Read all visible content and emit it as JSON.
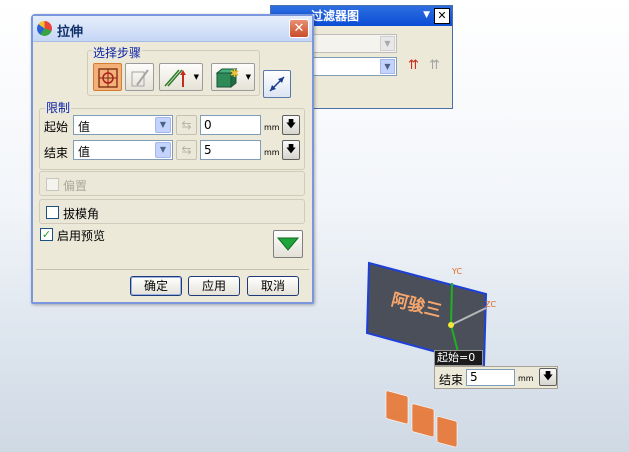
{
  "bg_window": {
    "title": "过滤器图",
    "symbols": [
      "⇈",
      "⇈"
    ]
  },
  "dialog": {
    "title": "拉伸",
    "close_glyph": "✕",
    "select_steps": {
      "label": "选择步骤"
    },
    "limits": {
      "label": "限制",
      "start": {
        "label": "起始",
        "type": "值",
        "value": "0",
        "unit": "mm"
      },
      "end": {
        "label": "结束",
        "type": "值",
        "value": "5",
        "unit": "mm"
      }
    },
    "offset": {
      "label": "偏置",
      "checked": false
    },
    "draft": {
      "label": "拔模角",
      "checked": false
    },
    "preview": {
      "label": "启用预览",
      "checked": true
    },
    "buttons": {
      "ok": "确定",
      "apply": "应用",
      "cancel": "取消"
    }
  },
  "viewport": {
    "axis_labels": {
      "yc": "YC",
      "zc": "ZC"
    },
    "extruded_text": "阿骏三",
    "start_tag": "起始=0",
    "end_tag": {
      "label": "结束",
      "value": "5",
      "unit": "mm"
    }
  },
  "colors": {
    "accent_orange": "#f3b078",
    "title_blue": "#0b4bd6",
    "group_label_blue": "#0a22a8",
    "solid_orange": "#e87b3c"
  }
}
